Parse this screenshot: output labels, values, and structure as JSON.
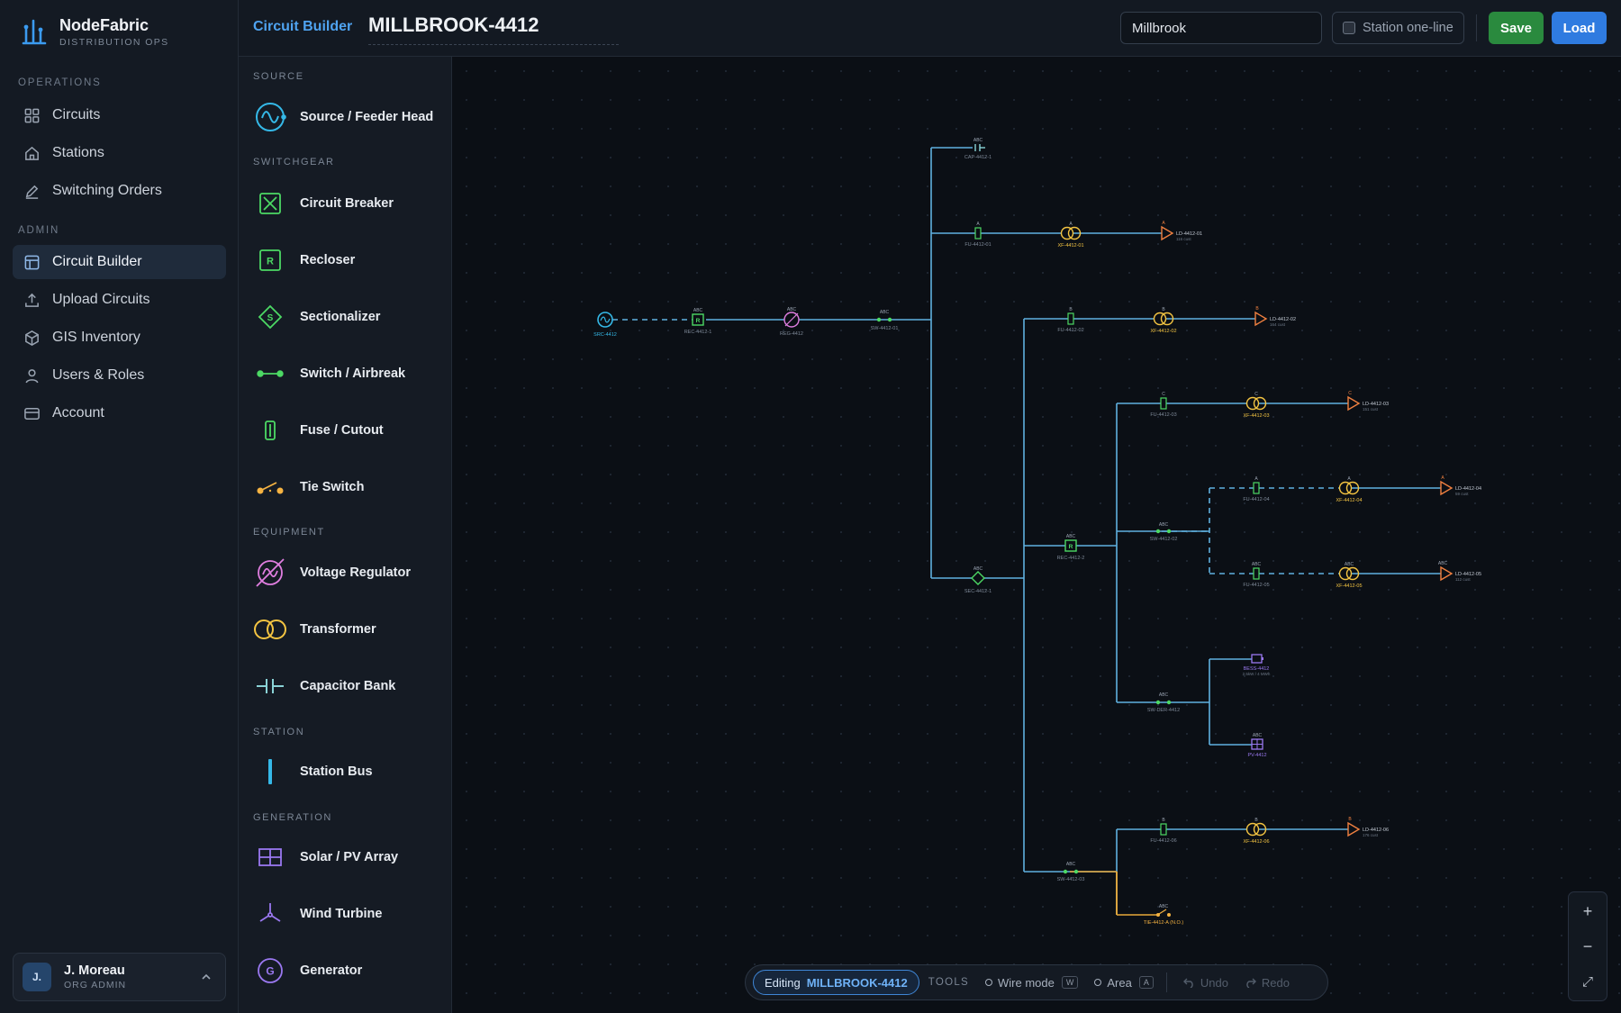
{
  "brand": {
    "name": "NodeFabric",
    "subtitle": "DISTRIBUTION OPS"
  },
  "nav": {
    "operations_label": "OPERATIONS",
    "operations": [
      {
        "label": "Circuits",
        "icon": "grid-icon"
      },
      {
        "label": "Stations",
        "icon": "station-icon"
      },
      {
        "label": "Switching Orders",
        "icon": "pencil-icon"
      }
    ],
    "admin_label": "ADMIN",
    "admin": [
      {
        "label": "Circuit Builder",
        "icon": "layout-icon",
        "active": true
      },
      {
        "label": "Upload Circuits",
        "icon": "upload-icon"
      },
      {
        "label": "GIS Inventory",
        "icon": "cube-icon"
      },
      {
        "label": "Users & Roles",
        "icon": "user-icon"
      },
      {
        "label": "Account",
        "icon": "card-icon"
      }
    ]
  },
  "user": {
    "initials": "J.",
    "name": "J. Moreau",
    "role": "ORG ADMIN"
  },
  "header": {
    "breadcrumb": "Circuit Builder",
    "circuit_title": "MILLBROOK-4412",
    "search_value": "Millbrook",
    "station_toggle": "Station one-line",
    "save": "Save",
    "load": "Load"
  },
  "palette": {
    "sections": [
      "SOURCE",
      "SWITCHGEAR",
      "EQUIPMENT",
      "STATION",
      "GENERATION"
    ],
    "items": [
      "Source / Feeder Head",
      "Circuit Breaker",
      "Recloser",
      "Sectionalizer",
      "Switch / Airbreak",
      "Fuse / Cutout",
      "Tie Switch",
      "Voltage Regulator",
      "Transformer",
      "Capacitor Bank",
      "Station Bus",
      "Solar / PV Array",
      "Wind Turbine",
      "Generator"
    ]
  },
  "diagram": {
    "labels": {
      "src": "SRC-4412",
      "rec1": "REC-4412-1",
      "reg": "REG-4412",
      "sw01": "SW-4412-01",
      "cap": "CAP-4412-1",
      "fu01": "FU-4412-01",
      "xf01": "XF-4412-01",
      "ld01": "LD-4412-01",
      "ld01sub": "116 cust",
      "fu02": "FU-4412-02",
      "xf02": "XF-4412-02",
      "ld02": "LD-4412-02",
      "ld02sub": "164 cust",
      "fu03": "FU-4412-03",
      "xf03": "XF-4412-03",
      "ld03": "LD-4412-03",
      "ld03sub": "151 cust",
      "fu04": "FU-4412-04",
      "xf04": "XF-4412-04",
      "ld04": "LD-4412-04",
      "ld04sub": "59 cust",
      "fu05": "FU-4412-05",
      "xf05": "XF-4412-05",
      "ld05": "LD-4412-05",
      "ld05sub": "112 cust",
      "sec": "SEC-4412-1",
      "rec2": "REC-4412-2",
      "sw02": "SW-4412-02",
      "swder": "SW-DER-4412",
      "bess": "BESS-4412",
      "besssub": "2.5kW / 4 MWh",
      "pv": "PV-4412",
      "sw03": "SW-4412-03",
      "fu06": "FU-4412-06",
      "xf06": "XF-4412-06",
      "ld06": "LD-4412-06",
      "ld06sub": "176 cust",
      "tie": "TIE-4412-A (N.O.)",
      "abc": "ABC",
      "phA": "A",
      "phB": "B",
      "phC": "C"
    }
  },
  "toolbar": {
    "editing_label": "Editing",
    "editing_value": "MILLBROOK-4412",
    "tools_label": "TOOLS",
    "wire": "Wire mode",
    "wire_key": "W",
    "area": "Area",
    "area_key": "A",
    "undo": "Undo",
    "redo": "Redo"
  },
  "zoom": {
    "in": "+",
    "out": "−",
    "fit": "⤢"
  }
}
